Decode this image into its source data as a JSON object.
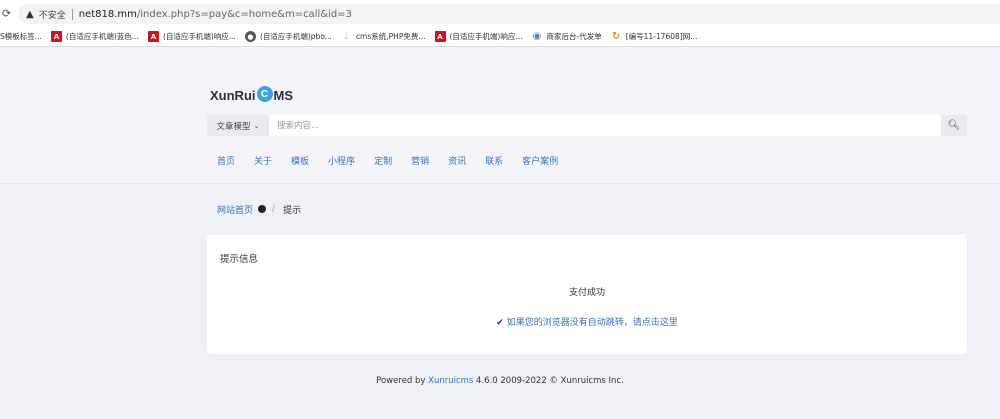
{
  "browser": {
    "insecure_label": "不安全",
    "url_host": "net818.mm",
    "url_path": "/index.php?s=pay&c=home&m=call&id=3"
  },
  "bookmarks": [
    {
      "icon": "tab-fragment",
      "label": "S模板标签..."
    },
    {
      "icon": "acrobat-icon",
      "label": "(自适应手机端)蓝色..."
    },
    {
      "icon": "acrobat-icon",
      "label": "(自适应手机端)响应..."
    },
    {
      "icon": "globe-icon",
      "label": "(自适应手机端)pbo..."
    },
    {
      "icon": "drop-icon",
      "label": "cms系统,PHP免费..."
    },
    {
      "icon": "acrobat-icon",
      "label": "(自适应手机端)响应..."
    },
    {
      "icon": "bell-icon",
      "label": "商家后台-代发单"
    },
    {
      "icon": "cc-icon",
      "label": "[编号11-17608]网..."
    }
  ],
  "site": {
    "logo_before": "XunRui",
    "logo_c": "C",
    "logo_after": "MS",
    "search_model": "文章模型",
    "search_placeholder": "搜索内容...",
    "nav": [
      "首页",
      "关于",
      "模板",
      "小程序",
      "定制",
      "营销",
      "资讯",
      "联系",
      "客户案例"
    ]
  },
  "breadcrumb": {
    "home": "网站首页",
    "separator": "/",
    "current": "提示"
  },
  "message": {
    "title": "提示信息",
    "text": "支付成功",
    "jump_text": "如果您的浏览器没有自动跳转，请点击这里"
  },
  "footer": {
    "powered": "Powered by ",
    "brand": "Xunruicms",
    "rest": " 4.6.0 2009-2022 © Xunruicms Inc."
  },
  "colors": {
    "link": "#3a73b8",
    "logo_accent": "#3aa1e6",
    "page_bg": "#eef1f5"
  }
}
